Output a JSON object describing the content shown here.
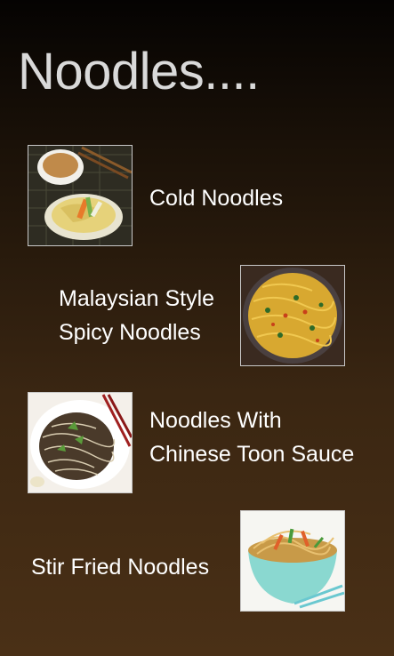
{
  "page": {
    "title": "Noodles...."
  },
  "recipes": [
    {
      "line1": "Cold Noodles",
      "line2": "",
      "image": "cold-noodles-photo"
    },
    {
      "line1": "Malaysian Style",
      "line2": "Spicy Noodles",
      "image": "malaysian-noodles-photo"
    },
    {
      "line1": "Noodles With",
      "line2": "Chinese Toon Sauce",
      "image": "toon-sauce-noodles-photo"
    },
    {
      "line1": "Stir Fried Noodles",
      "line2": "",
      "image": "stir-fried-noodles-photo"
    }
  ]
}
